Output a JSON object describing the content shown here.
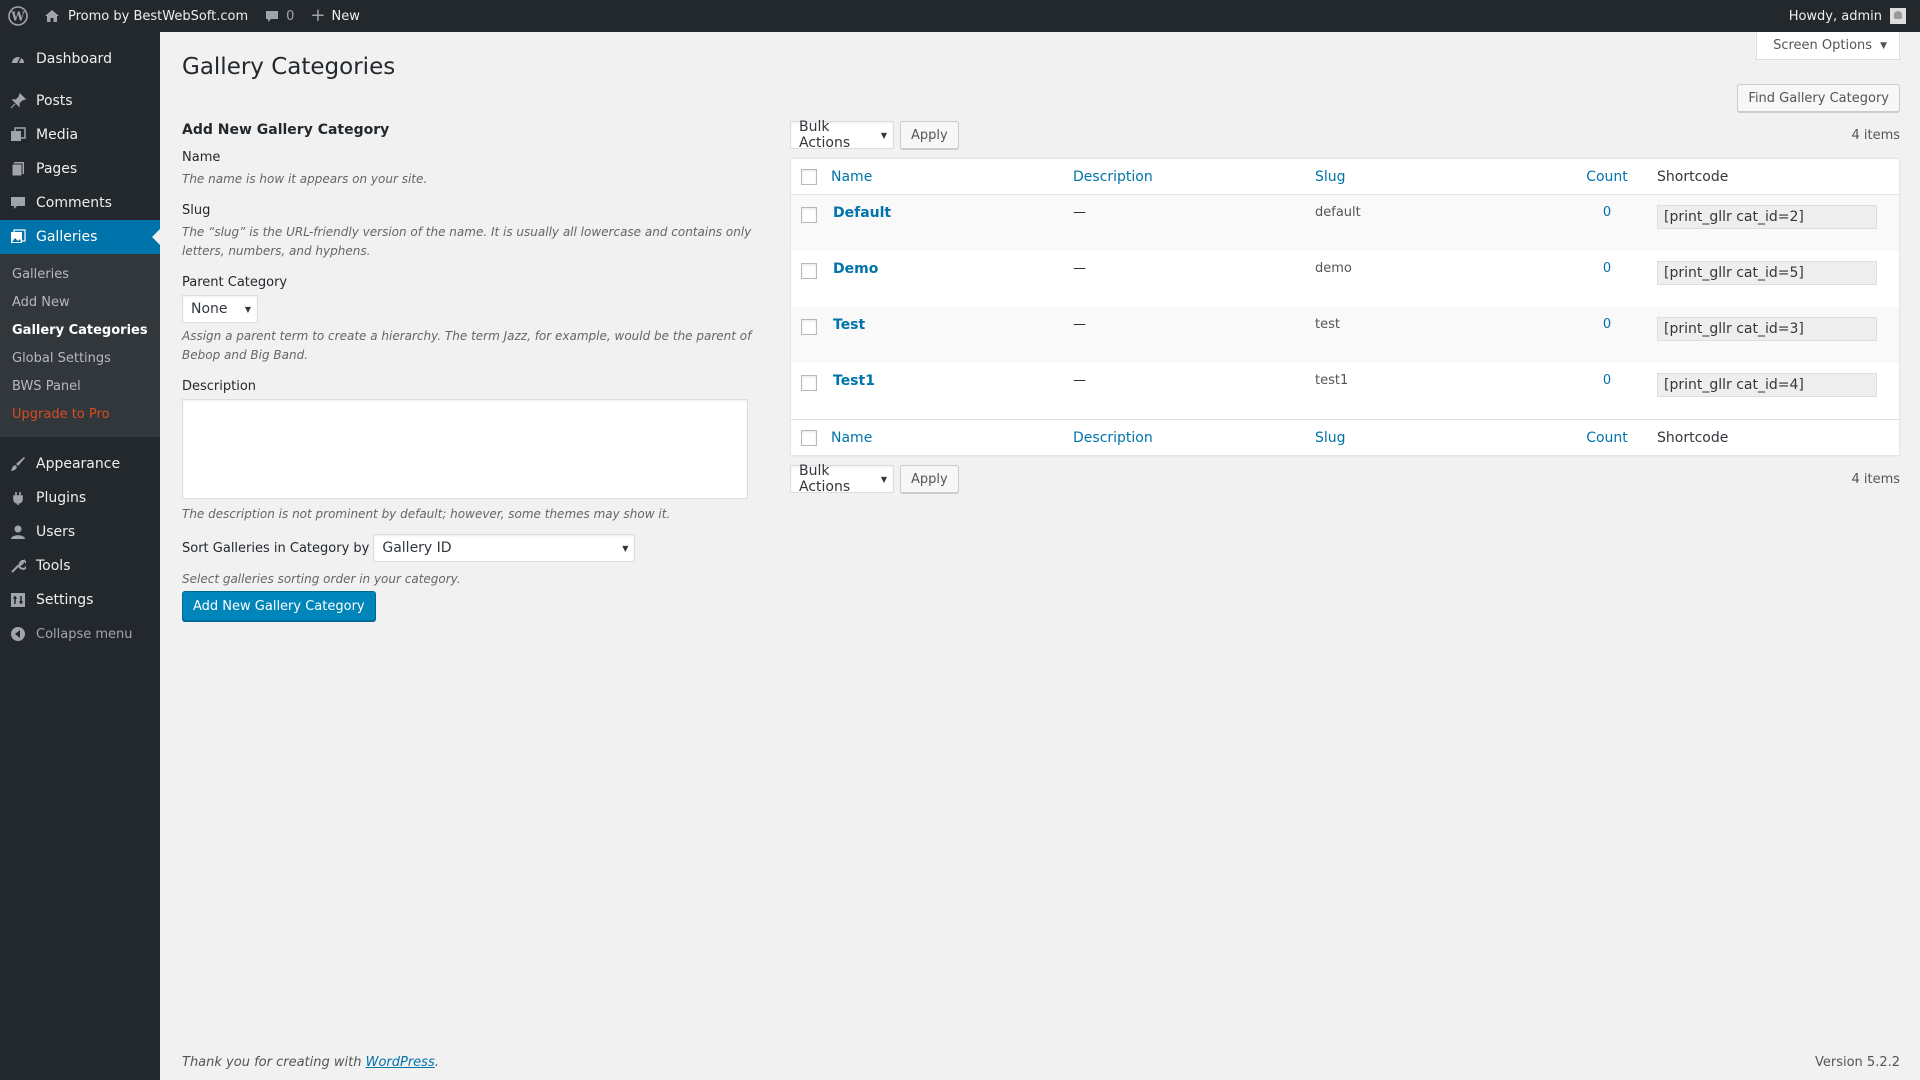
{
  "adminbar": {
    "site_name": "Promo by BestWebSoft.com",
    "comments_count": "0",
    "new_label": "New",
    "howdy": "Howdy, admin"
  },
  "sidebar": {
    "items": [
      {
        "label": "Dashboard",
        "icon": "dashboard-icon"
      },
      {
        "label": "Posts",
        "icon": "pin-icon"
      },
      {
        "label": "Media",
        "icon": "media-icon"
      },
      {
        "label": "Pages",
        "icon": "pages-icon"
      },
      {
        "label": "Comments",
        "icon": "comment-icon"
      },
      {
        "label": "Galleries",
        "icon": "gallery-icon"
      },
      {
        "label": "Appearance",
        "icon": "brush-icon"
      },
      {
        "label": "Plugins",
        "icon": "plugin-icon"
      },
      {
        "label": "Users",
        "icon": "user-icon"
      },
      {
        "label": "Tools",
        "icon": "wrench-icon"
      },
      {
        "label": "Settings",
        "icon": "settings-icon"
      }
    ],
    "submenu": [
      "Galleries",
      "Add New",
      "Gallery Categories",
      "Global Settings",
      "BWS Panel",
      "Upgrade to Pro"
    ],
    "collapse_label": "Collapse menu"
  },
  "header": {
    "screen_options": "Screen Options",
    "title": "Gallery Categories",
    "find_button": "Find Gallery Category"
  },
  "form": {
    "heading": "Add New Gallery Category",
    "name_label": "Name",
    "name_desc": "The name is how it appears on your site.",
    "slug_label": "Slug",
    "slug_desc": "The “slug” is the URL-friendly version of the name. It is usually all lowercase and contains only letters, numbers, and hyphens.",
    "parent_label": "Parent Category",
    "parent_value": "None",
    "parent_desc": "Assign a parent term to create a hierarchy. The term Jazz, for example, would be the parent of Bebop and Big Band.",
    "description_label": "Description",
    "description_desc": "The description is not prominent by default; however, some themes may show it.",
    "sort_label": "Sort Galleries in Category by",
    "sort_value": "Gallery ID",
    "sort_desc": "Select galleries sorting order in your category.",
    "submit_label": "Add New Gallery Category"
  },
  "table": {
    "bulk_actions": "Bulk Actions",
    "apply": "Apply",
    "items_count": "4 items",
    "columns": {
      "name": "Name",
      "description": "Description",
      "slug": "Slug",
      "count": "Count",
      "shortcode": "Shortcode"
    },
    "rows": [
      {
        "name": "Default",
        "description": "—",
        "slug": "default",
        "count": "0",
        "shortcode": "[print_gllr cat_id=2]"
      },
      {
        "name": "Demo",
        "description": "—",
        "slug": "demo",
        "count": "0",
        "shortcode": "[print_gllr cat_id=5]"
      },
      {
        "name": "Test",
        "description": "—",
        "slug": "test",
        "count": "0",
        "shortcode": "[print_gllr cat_id=3]"
      },
      {
        "name": "Test1",
        "description": "—",
        "slug": "test1",
        "count": "0",
        "shortcode": "[print_gllr cat_id=4]"
      }
    ]
  },
  "footer": {
    "thanks_prefix": "Thank you for creating with",
    "wordpress_link": "WordPress",
    "thanks_suffix": ".",
    "version": "Version 5.2.2"
  },
  "colors": {
    "admin_bg": "#23282d",
    "accent": "#0073aa",
    "primary_button": "#0085ba",
    "upgrade": "#d54e21"
  }
}
